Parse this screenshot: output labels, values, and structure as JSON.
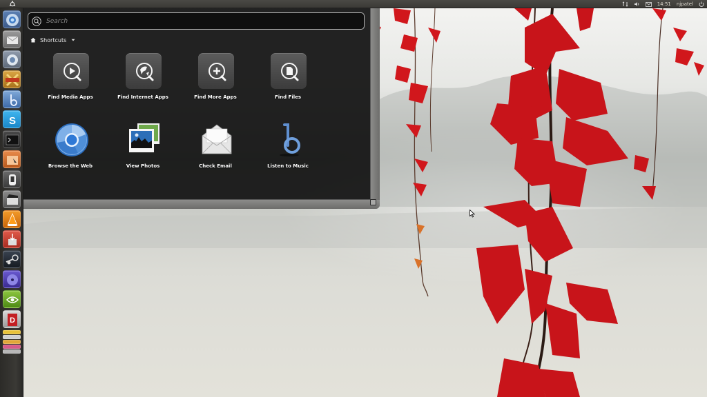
{
  "top_panel": {
    "logo": "ubuntu-logo-icon",
    "indicators": {
      "network": "network-icon",
      "volume": "volume-icon",
      "mail": "mail-icon",
      "clock": "14:51",
      "user": "njpatel",
      "power": "power-icon"
    }
  },
  "launcher": {
    "items": [
      {
        "icon": "chromium-browser-icon",
        "active": true
      },
      {
        "icon": "mail-client-icon"
      },
      {
        "icon": "network-app-icon"
      },
      {
        "icon": "cmix-icon"
      },
      {
        "icon": "banshee-icon"
      },
      {
        "icon": "skype-icon"
      },
      {
        "icon": "terminal-icon"
      },
      {
        "icon": "file-manager-icon"
      },
      {
        "icon": "usb-creator-icon"
      },
      {
        "icon": "video-editor-icon"
      },
      {
        "icon": "vlc-icon"
      },
      {
        "icon": "archive-manager-icon"
      },
      {
        "icon": "steam-icon"
      },
      {
        "icon": "media-player-icon"
      },
      {
        "icon": "nvidia-icon"
      },
      {
        "icon": "dictionary-icon"
      }
    ]
  },
  "dash": {
    "search": {
      "placeholder": "Search",
      "value": ""
    },
    "section_label": "Shortcuts",
    "shortcuts_row1": [
      {
        "label": "Find Media Apps",
        "icon": "find-media-apps-icon"
      },
      {
        "label": "Find Internet Apps",
        "icon": "find-internet-apps-icon"
      },
      {
        "label": "Find More Apps",
        "icon": "find-more-apps-icon"
      },
      {
        "label": "Find Files",
        "icon": "find-files-icon"
      }
    ],
    "shortcuts_row2": [
      {
        "label": "Browse the Web",
        "icon": "chromium-icon"
      },
      {
        "label": "View Photos",
        "icon": "photo-viewer-icon"
      },
      {
        "label": "Check Email",
        "icon": "email-envelope-icon"
      },
      {
        "label": "Listen to Music",
        "icon": "banshee-music-icon"
      }
    ]
  },
  "colors": {
    "panel": "#3b3a36",
    "launcher": "#33322f",
    "dash": "#121212",
    "accent_leaf": "#c8141a"
  }
}
